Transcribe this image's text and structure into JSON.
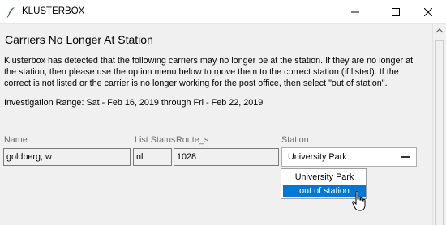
{
  "window": {
    "title": "KLUSTERBOX",
    "icon": "feather-icon"
  },
  "page": {
    "heading": "Carriers No Longer At Station",
    "description": "Klusterbox has detected that the following carriers may no longer be at the station. If they are no longer at the station, then please use the option menu below to move them to the correct station (if listed). If the correct is not listed or the carrier is no longer working for the post office, then select \"out of station\".",
    "investigation_range": "Investigation Range: Sat - Feb 16, 2019 through Fri - Feb 22, 2019"
  },
  "table": {
    "headers": {
      "name": "Name",
      "list_status": "List Status",
      "route": "Route_s",
      "station": "Station"
    },
    "rows": [
      {
        "name": "goldberg, w",
        "list_status": "nl",
        "route": "1028",
        "station": "University Park"
      }
    ]
  },
  "station_menu": {
    "selected": "University Park",
    "options": [
      "University Park",
      "out of station"
    ],
    "highlighted": "out of station"
  },
  "colors": {
    "highlight": "#0078d7",
    "window_bg": "#f0f0f0"
  }
}
